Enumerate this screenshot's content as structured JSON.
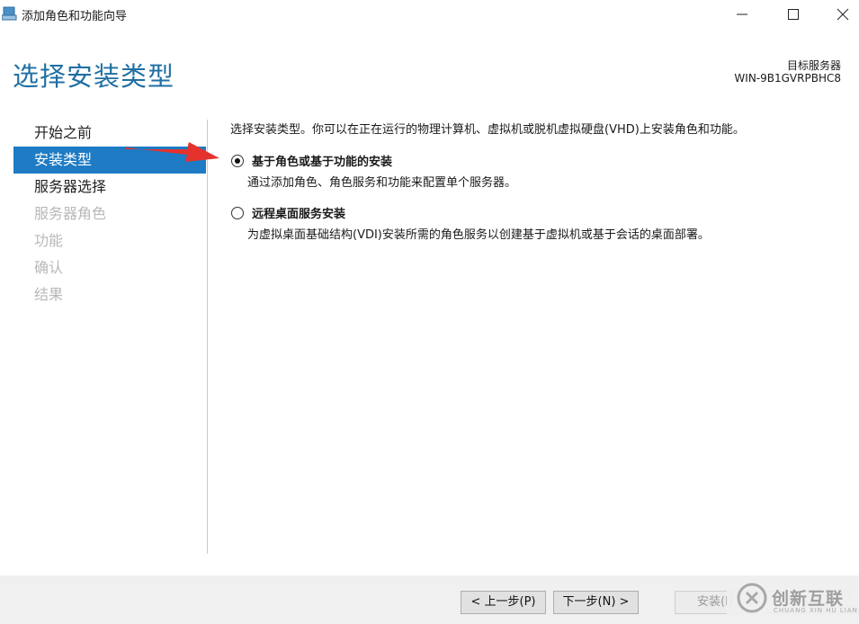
{
  "window": {
    "title": "添加角色和功能向导"
  },
  "header": {
    "page_title": "选择安装类型",
    "target_label": "目标服务器",
    "target_value": "WIN-9B1GVRPBHC8"
  },
  "sidebar": {
    "items": [
      {
        "label": "开始之前",
        "state": "normal"
      },
      {
        "label": "安装类型",
        "state": "active"
      },
      {
        "label": "服务器选择",
        "state": "normal"
      },
      {
        "label": "服务器角色",
        "state": "disabled"
      },
      {
        "label": "功能",
        "state": "disabled"
      },
      {
        "label": "确认",
        "state": "disabled"
      },
      {
        "label": "结果",
        "state": "disabled"
      }
    ]
  },
  "main": {
    "description": "选择安装类型。你可以在正在运行的物理计算机、虚拟机或脱机虚拟硬盘(VHD)上安装角色和功能。",
    "options": [
      {
        "label": "基于角色或基于功能的安装",
        "description": "通过添加角色、角色服务和功能来配置单个服务器。",
        "selected": true
      },
      {
        "label": "远程桌面服务安装",
        "description": "为虚拟桌面基础结构(VDI)安装所需的角色服务以创建基于虚拟机或基于会话的桌面部署。",
        "selected": false
      }
    ]
  },
  "footer": {
    "prev_label": "< 上一步(P)",
    "next_label": "下一步(N) >",
    "install_label": "安装(I)",
    "cancel_label": ""
  },
  "watermark": {
    "text": "创新互联",
    "sub": "CHUANG XIN HU LIAN"
  },
  "colors": {
    "accent": "#1e7bc4",
    "title_blue": "#1f6fa4",
    "arrow_red": "#e5322d"
  }
}
